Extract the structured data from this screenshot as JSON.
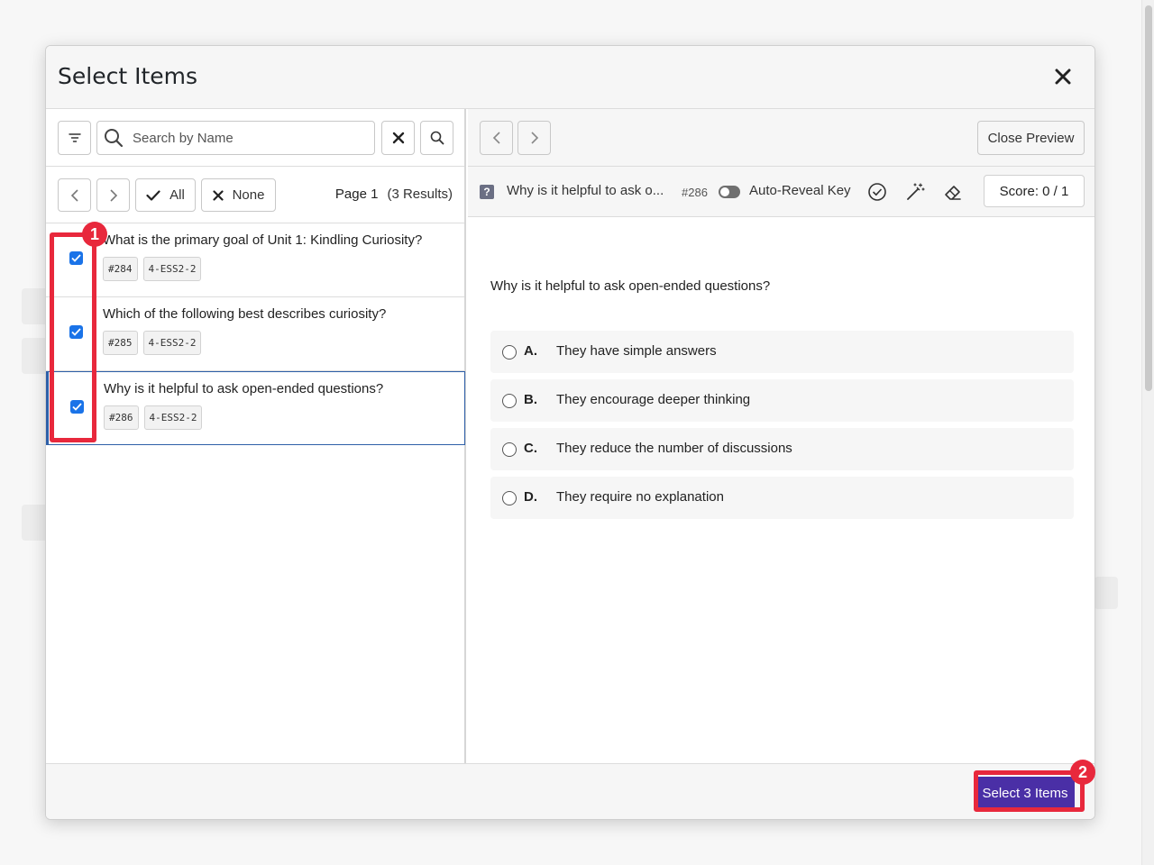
{
  "modal": {
    "title": "Select Items"
  },
  "search": {
    "placeholder": "Search by Name",
    "value": ""
  },
  "pager": {
    "select_all_label": "All",
    "select_none_label": "None",
    "page_label": "Page 1",
    "results_label": "(3 Results)"
  },
  "items": [
    {
      "title": "What is the primary goal of Unit 1: Kindling Curiosity?",
      "id_tag": "#284",
      "standard_tag": "4-ESS2-2",
      "checked": true
    },
    {
      "title": "Which of the following best describes curiosity?",
      "id_tag": "#285",
      "standard_tag": "4-ESS2-2",
      "checked": true
    },
    {
      "title": "Why is it helpful to ask open-ended questions?",
      "id_tag": "#286",
      "standard_tag": "4-ESS2-2",
      "checked": true
    }
  ],
  "preview": {
    "close_label": "Close Preview",
    "question_title": "Why is it helpful to ask o...",
    "question_number": "#286",
    "auto_reveal_label": "Auto-Reveal Key",
    "score_label": "Score: 0 / 1",
    "prompt": "Why is it helpful to ask open-ended questions?",
    "choices": [
      {
        "letter": "A.",
        "text": "They have simple answers"
      },
      {
        "letter": "B.",
        "text": "They encourage deeper thinking"
      },
      {
        "letter": "C.",
        "text": "They reduce the number of discussions"
      },
      {
        "letter": "D.",
        "text": "They require no explanation"
      }
    ]
  },
  "footer": {
    "select_button_label": "Select 3 Items"
  },
  "annotations": [
    {
      "label": "1"
    },
    {
      "label": "2"
    }
  ],
  "colors": {
    "primary": "#4a2fa6",
    "annotation": "#e8283c",
    "selection": "#2e5fa8",
    "checkbox": "#1a73e8"
  }
}
